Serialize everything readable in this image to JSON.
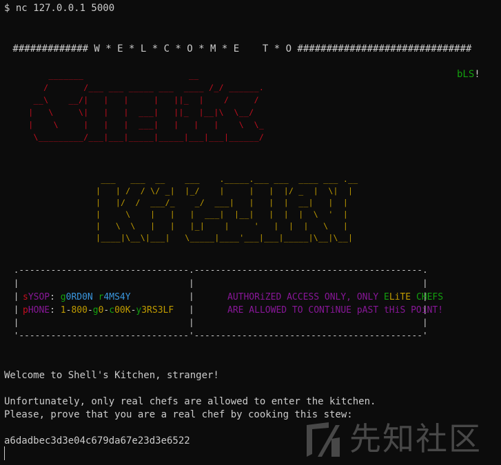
{
  "terminal": {
    "prompt_line": "$ nc 127.0.0.1 5000",
    "banner_line": " ############# W * E * L * C * O * M * E    T * O ##############################",
    "bls_prefix": "bLS",
    "bls_suffix": "!",
    "shell_ascii": "     _______                     __\n    /       /___ ___ _____ ___  ____ /_/ ______.\n  __\\    __/|   |   |     |   ||_  |    /     /\n |   \\     \\|   |   |  ___|   ||_  |__|\\  \\__/\n |    \\     |   |   |  ___|   |   |   |    \\  \\_\n  \\_________/___|___|_____|_____|___|___|______/",
    "kitchen_ascii": "  ___   ___  __    ___    ._____.___ ___  ____ ___ .__\n |   | /  / \\/ _|  |_/    |     |   |  |/ _  |  \\|  |\n |   |/  /  ___/_    _/  ___|   |   |  |  __|   |  |\n |     \\    |   |   |  ___|  |__|   |  |  |  \\  '  |\n |   \\  \\   |   |   |_|    |     '   |  |  |   \\   |\n |____|\\__\\|___|   \\_____|____'___|___|_____|\\__|\\__|",
    "box_frame": " .--------------------------------.-------------------------------------------.\n |                                |                                           |\n |                                |                                           |\n |                                |                                           |\n |                                |                                           |\n '--------------------------------'-------------------------------------------'",
    "sysop": {
      "s_label": "s",
      "rest_label": "YSOP",
      "colon": ": ",
      "g": "g",
      "name1": "0RD0N",
      "space": " ",
      "r": "r",
      "name2": "4MS4Y"
    },
    "phone": {
      "p_label": "p",
      "rest_label": "HONE",
      "colon": ": ",
      "n1": "1",
      "d1": "-",
      "n2": "8",
      "n3": "00",
      "d2": "-",
      "g": "g",
      "n4": "0",
      "d3": "-",
      "c": "c",
      "n5": "00K",
      "d4": "-",
      "y": "y",
      "n6": "3RS3LF"
    },
    "auth_line1": {
      "part1": "AUTHORiZED ACCESS ONLY, ONLY ",
      "elite_e": "E",
      "elite_rest": "LiTE ",
      "chefs_c": "C",
      "chefs_rest": "HEFS"
    },
    "auth_line2": "ARE ALLOWED TO CONTiNUE pAST tHiS POiNT!",
    "welcome": "Welcome to Shell's Kitchen, stranger!",
    "unfortunately": "Unfortunately, only real chefs are allowed to enter the kitchen.",
    "please": "Please, prove that you are a real chef by cooking this stew:",
    "hash": "a6dadbec3d3e04c679da67e23d3e6522"
  },
  "watermark": {
    "text": "先知社区"
  },
  "colors": {
    "background": "#0c0c0c",
    "foreground": "#cccccc",
    "red": "#c50f1f",
    "green": "#13a10e",
    "yellow": "#c19c00",
    "blue": "#3a96dd",
    "purple": "#881798"
  }
}
